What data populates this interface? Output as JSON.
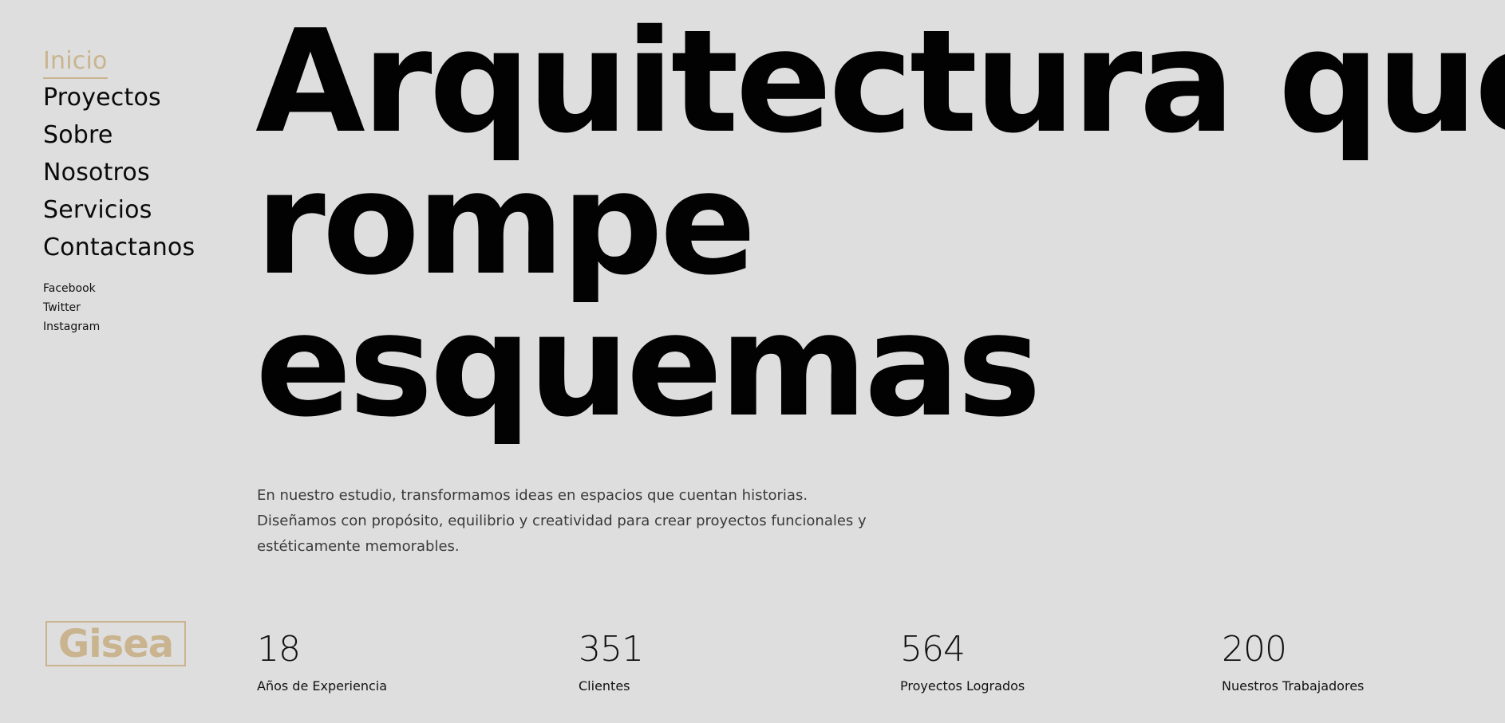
{
  "nav": {
    "items": [
      {
        "label": "Inicio",
        "active": true
      },
      {
        "label": "Proyectos"
      },
      {
        "label": "Sobre"
      },
      {
        "label": "Nosotros"
      },
      {
        "label": "Servicios"
      },
      {
        "label": "Contactanos"
      }
    ],
    "social": [
      "Facebook",
      "Twitter",
      "Instagram"
    ]
  },
  "hero": {
    "lines": [
      "Arquitectura que",
      "rompe",
      "esquemas"
    ]
  },
  "intro": {
    "lines": [
      "En nuestro estudio, transformamos ideas en espacios que cuentan historias.",
      "Diseñamos con propósito, equilibrio y creatividad para crear proyectos funcionales y",
      "estéticamente memorables."
    ]
  },
  "logo": {
    "text": "Gisea"
  },
  "stats": [
    {
      "value": "18",
      "label": "Años de Experiencia"
    },
    {
      "value": "351",
      "label": "Clientes"
    },
    {
      "value": "564",
      "label": "Proyectos Logrados"
    },
    {
      "value": "200",
      "label": "Nuestros Trabajadores"
    }
  ],
  "colors": {
    "background": "#dedede",
    "accent": "#c9b48f",
    "text": "#020202",
    "body_text": "#3a3a3a"
  }
}
